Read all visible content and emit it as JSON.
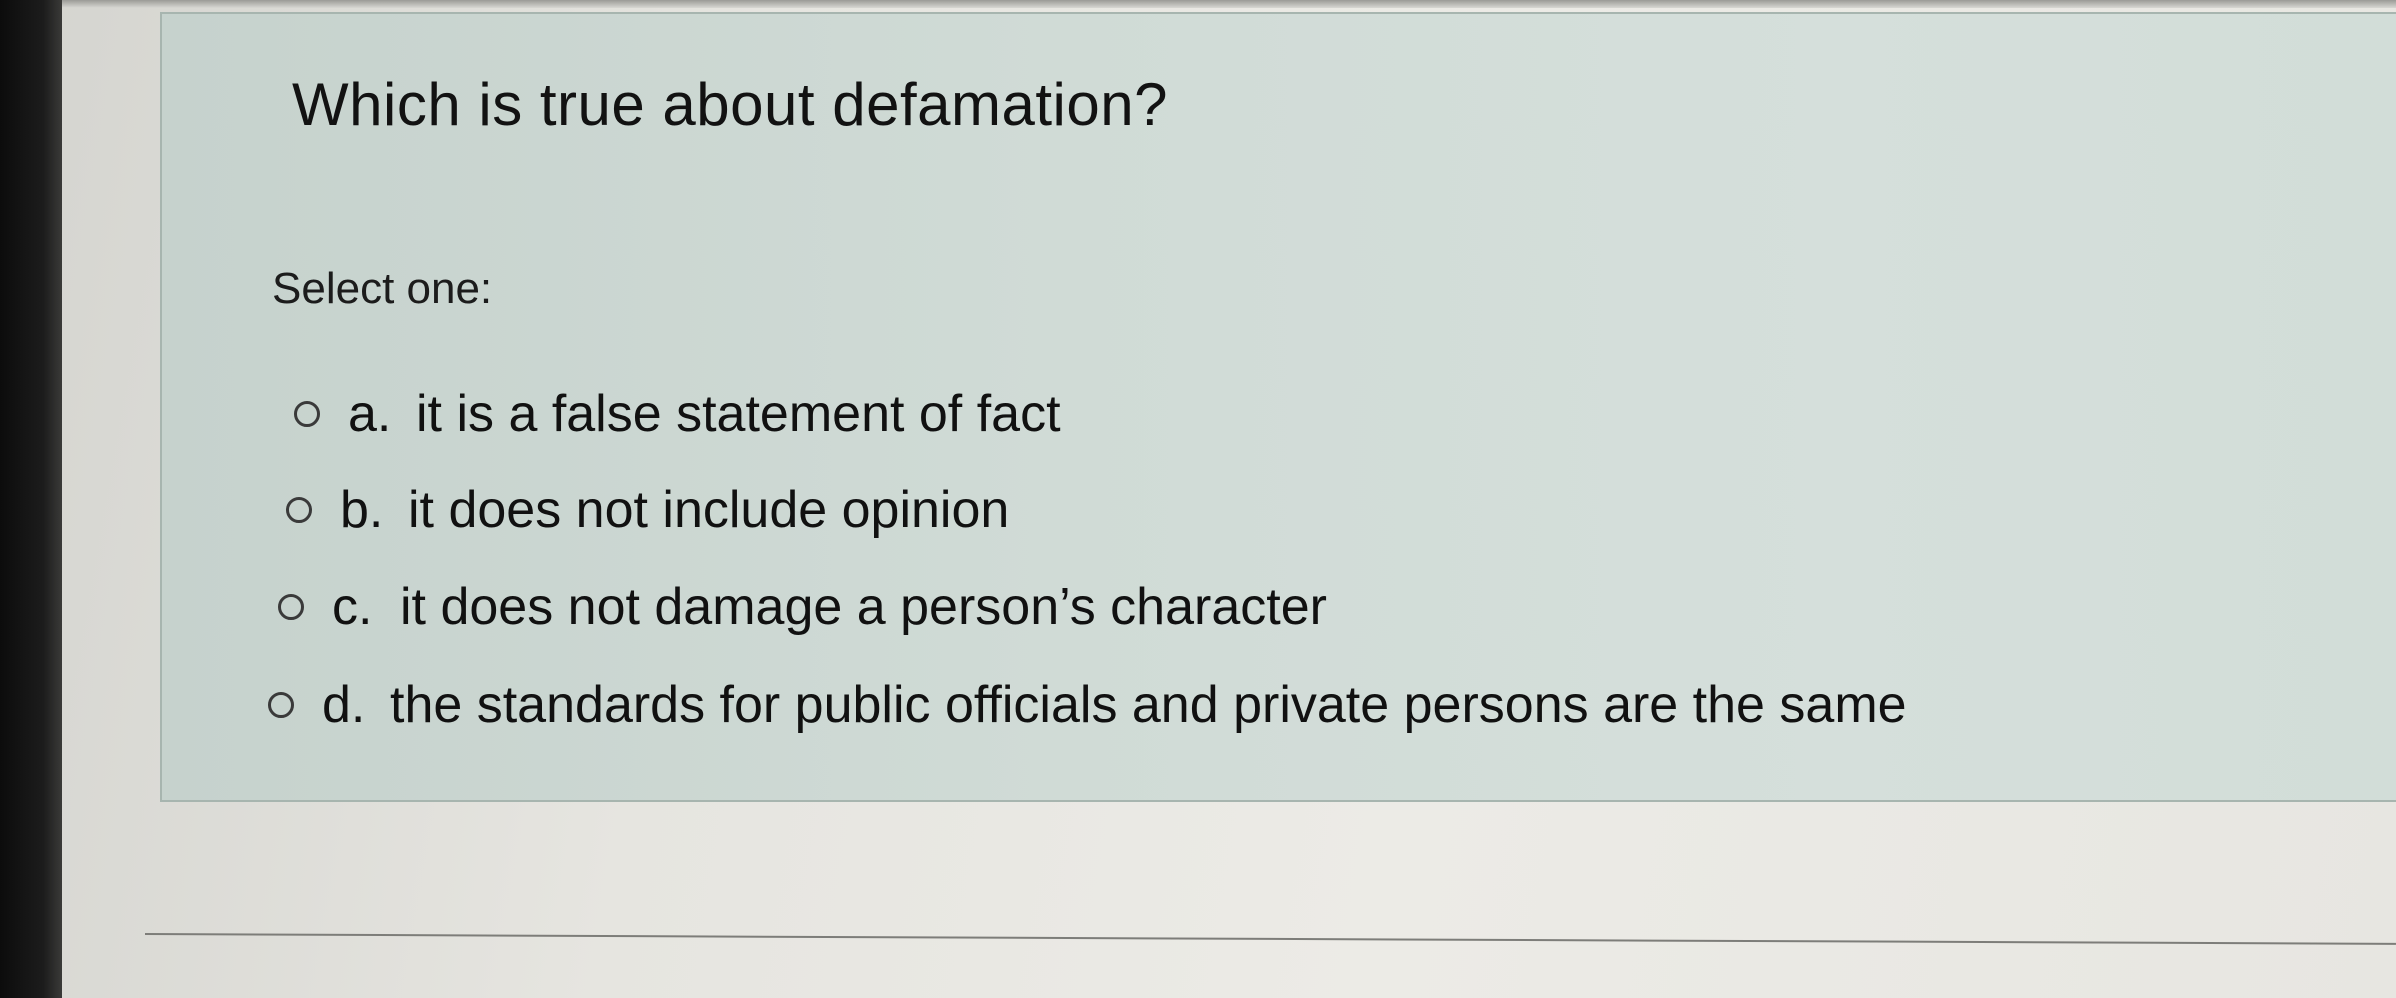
{
  "question": {
    "text": "Which is true about defamation?",
    "prompt": "Select one:",
    "options": [
      {
        "letter": "a.",
        "text": "it is a false statement of fact",
        "selected": false
      },
      {
        "letter": "b.",
        "text": "it does not include opinion",
        "selected": false
      },
      {
        "letter": "c.",
        "text": "it does not damage a person’s character",
        "selected": false
      },
      {
        "letter": "d.",
        "text": "the standards for public officials and private persons are the same",
        "selected": false
      }
    ]
  },
  "colors": {
    "card_background": "#d0dbd6",
    "card_border": "#a7b5af",
    "text": "#121212"
  }
}
